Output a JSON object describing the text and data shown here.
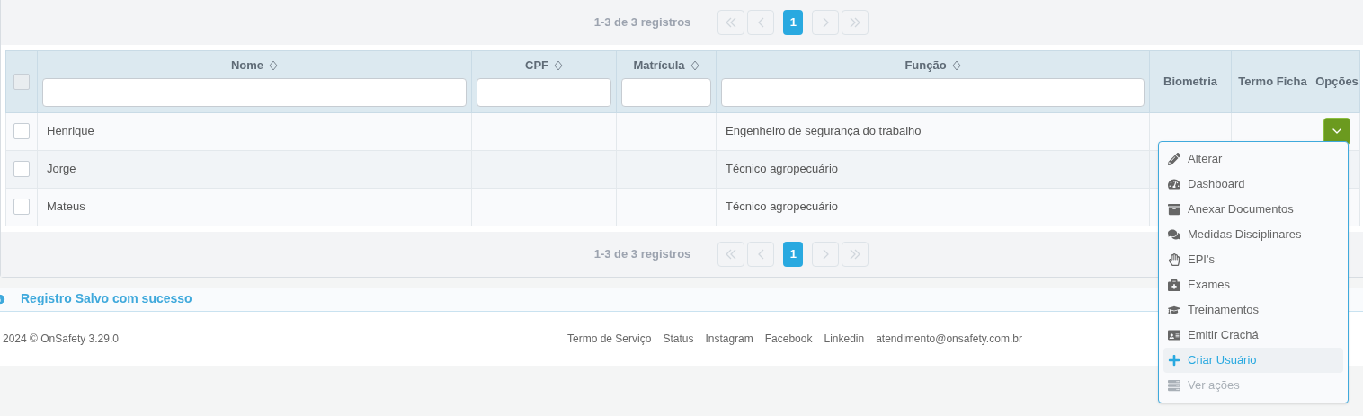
{
  "pager_top": {
    "summary": "1-3 de 3 registros",
    "nav": [
      {
        "kind": "first",
        "disabled": true
      },
      {
        "kind": "prev",
        "disabled": true
      },
      {
        "kind": "page",
        "label": "1",
        "selected": true
      },
      {
        "kind": "next",
        "disabled": true
      },
      {
        "kind": "last",
        "disabled": true
      }
    ]
  },
  "table": {
    "columns": [
      {
        "label": "Nome",
        "kind": "filter"
      },
      {
        "label": "CPF",
        "kind": "filter"
      },
      {
        "label": "Matrícula",
        "kind": "filter"
      },
      {
        "label": "Função",
        "kind": "filter"
      },
      {
        "label": "Biometria",
        "kind": "plain"
      },
      {
        "label": "Termo Ficha",
        "kind": "plain"
      },
      {
        "label": "Opções",
        "kind": "plain"
      }
    ],
    "select_all": {
      "checked": false
    },
    "rows": [
      {
        "checked": false,
        "options_button": true,
        "cells": [
          "Henrique",
          "",
          "",
          "Engenheiro de segurança do trabalho",
          "",
          ""
        ]
      },
      {
        "checked": false,
        "options_button": false,
        "cells": [
          "Jorge",
          "",
          "",
          "Técnico agropecuário",
          "",
          ""
        ]
      },
      {
        "checked": false,
        "options_button": false,
        "cells": [
          "Mateus",
          "",
          "",
          "Técnico agropecuário",
          "",
          ""
        ]
      }
    ]
  },
  "options_menu": {
    "open": true,
    "items": [
      {
        "label": "Alterar",
        "selected": false,
        "disabled": false
      },
      {
        "label": "Dashboard",
        "selected": false,
        "disabled": false
      },
      {
        "label": "Anexar Documentos",
        "selected": false,
        "disabled": false
      },
      {
        "label": "Medidas Disciplinares",
        "selected": false,
        "disabled": false
      },
      {
        "label": "EPI's",
        "selected": false,
        "disabled": false
      },
      {
        "label": "Exames",
        "selected": false,
        "disabled": false
      },
      {
        "label": "Treinamentos",
        "selected": false,
        "disabled": false
      },
      {
        "label": "Emitir Crachá",
        "selected": false,
        "disabled": false
      },
      {
        "label": "Criar Usuário",
        "selected": true,
        "disabled": false
      },
      {
        "label": "Ver ações",
        "selected": false,
        "disabled": true
      }
    ]
  },
  "pager_bottom": {
    "summary": "1-3 de 3 registros",
    "nav": [
      {
        "kind": "first",
        "disabled": true
      },
      {
        "kind": "prev",
        "disabled": true
      },
      {
        "kind": "page",
        "label": "1",
        "selected": true
      },
      {
        "kind": "next",
        "disabled": true
      },
      {
        "kind": "last",
        "disabled": true
      }
    ]
  },
  "message": {
    "text": "Registro Salvo com sucesso"
  },
  "footer": {
    "copyright": "2024 © OnSafety 3.29.0",
    "links": [
      "Termo de Serviço",
      "Status",
      "Instagram",
      "Facebook",
      "Linkedin",
      "atendimento@onsafety.com.br"
    ]
  }
}
